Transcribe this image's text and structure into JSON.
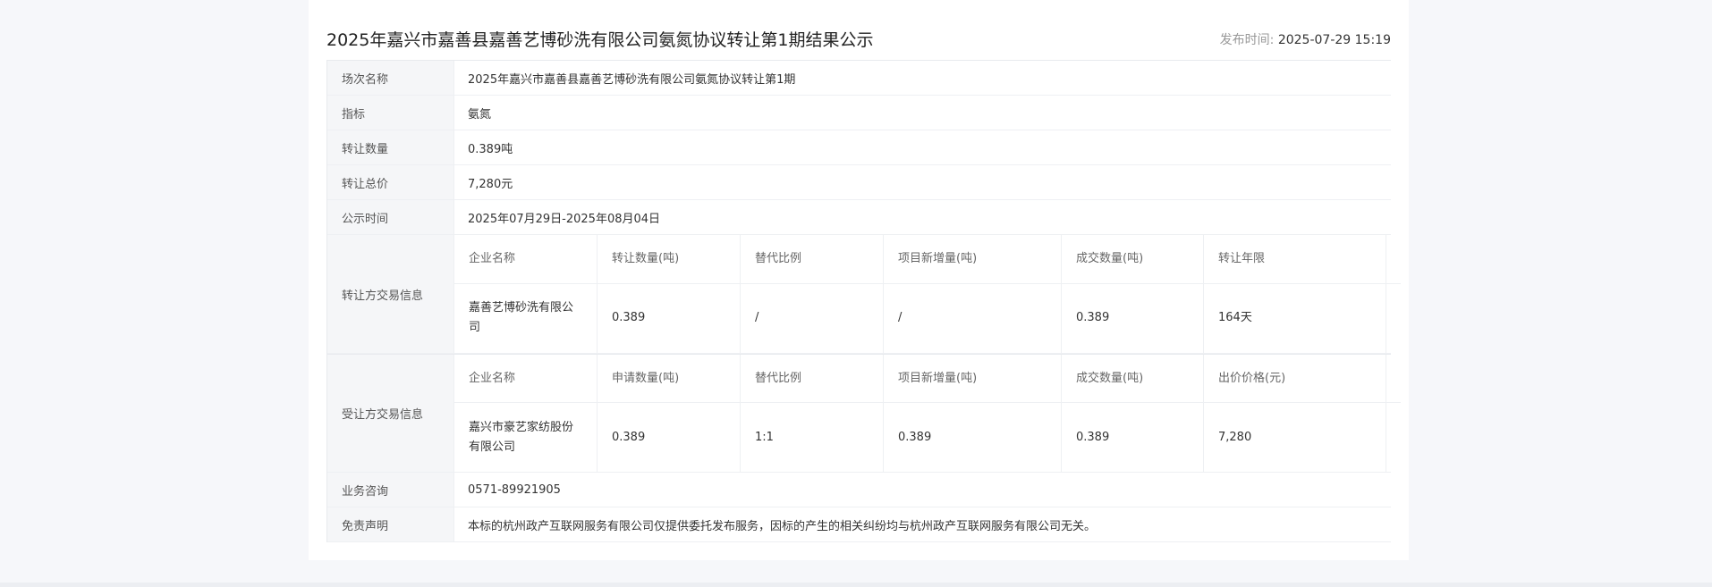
{
  "header": {
    "title": "2025年嘉兴市嘉善县嘉善艺博砂洗有限公司氨氮协议转让第1期结果公示",
    "pub_label": "发布时间:",
    "pub_time": "2025-07-29 15:19"
  },
  "rows": [
    {
      "label": "场次名称",
      "value": "2025年嘉兴市嘉善县嘉善艺博砂洗有限公司氨氮协议转让第1期"
    },
    {
      "label": "指标",
      "value": "氨氮"
    },
    {
      "label": "转让数量",
      "value": "0.389吨"
    },
    {
      "label": "转让总价",
      "value": "7,280元"
    },
    {
      "label": "公示时间",
      "value": "2025年07月29日-2025年08月04日"
    }
  ],
  "transferor": {
    "label": "转让方交易信息",
    "headers": [
      "企业名称",
      "转让数量(吨)",
      "替代比例",
      "项目新增量(吨)",
      "成交数量(吨)",
      "转让年限",
      ""
    ],
    "values": [
      "嘉善艺博砂洗有限公司",
      "0.389",
      "/",
      "/",
      "0.389",
      "164天",
      ""
    ]
  },
  "transferee": {
    "label": "受让方交易信息",
    "headers": [
      "企业名称",
      "申请数量(吨)",
      "替代比例",
      "项目新增量(吨)",
      "成交数量(吨)",
      "出价价格(元)",
      ""
    ],
    "values": [
      "嘉兴市豪艺家纺股份有限公司",
      "0.389",
      "1:1",
      "0.389",
      "0.389",
      "7,280",
      ""
    ]
  },
  "bottom_rows": [
    {
      "label": "业务咨询",
      "value": "0571-89921905"
    },
    {
      "label": "免责声明",
      "value": "本标的杭州政产互联网服务有限公司仅提供委托发布服务，因标的产生的相关纠纷均与杭州政产互联网服务有限公司无关。"
    }
  ]
}
